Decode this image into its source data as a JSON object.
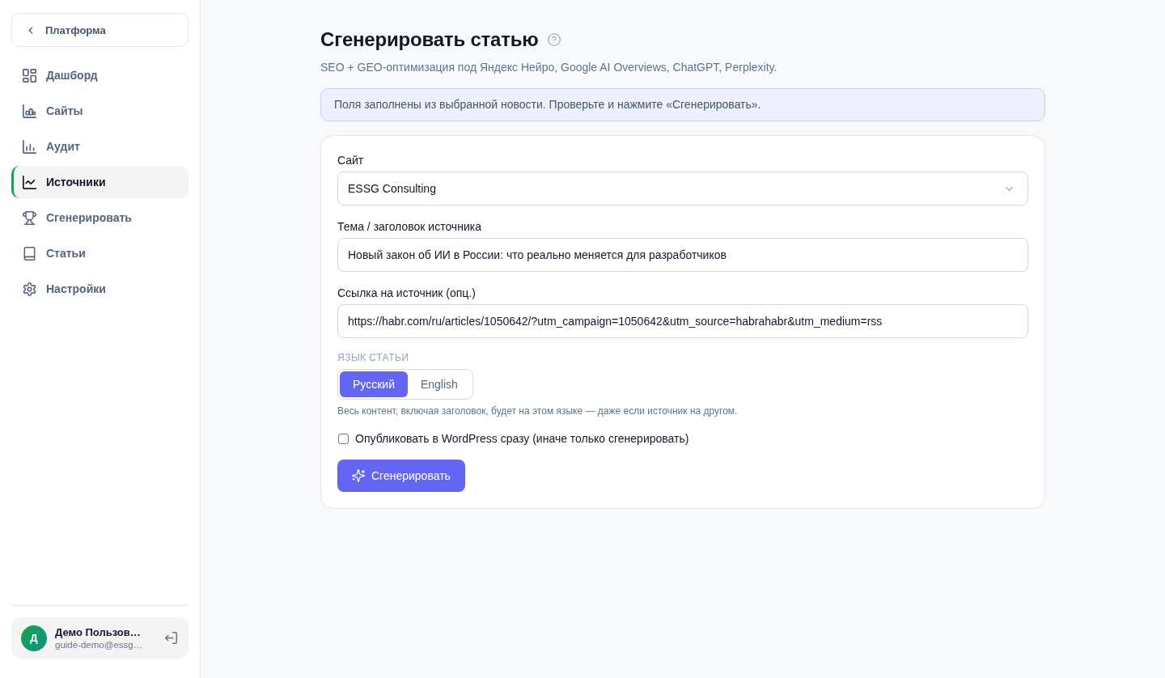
{
  "sidebar": {
    "back_button": {
      "label": "Платформа"
    },
    "nav": [
      {
        "label": "Дашборд",
        "selected": false
      },
      {
        "label": "Сайты",
        "selected": false
      },
      {
        "label": "Аудит",
        "selected": false
      },
      {
        "label": "Источники",
        "selected": true
      },
      {
        "label": "Сгенерировать",
        "selected": false
      },
      {
        "label": "Статьи",
        "selected": false
      },
      {
        "label": "Настройки",
        "selected": false
      }
    ],
    "user": {
      "avatar": "Д",
      "name": "Демо Пользов…",
      "email": "guide-demo@essg…"
    }
  },
  "page": {
    "title": "Сгенерировать статью",
    "subtitle": "SEO + GEO-оптимизация под Яндекс Нейро, Google AI Overviews, ChatGPT, Perplexity."
  },
  "notice": "Поля заполнены из выбранной новости. Проверьте и нажмите «Сгенерировать».",
  "form": {
    "fields": [
      {
        "kind": "select",
        "label": "Сайт",
        "value": "ESSG Consulting"
      },
      {
        "kind": "text",
        "label": "Тема / заголовок источника",
        "value": "Новый закон об ИИ в России: что реально меняется для разработчиков"
      },
      {
        "kind": "text",
        "label": "Ссылка на источник (опц.)",
        "value": "https://habr.com/ru/articles/1050642/?utm_campaign=1050642&utm_source=habrahabr&utm_medium=rss"
      }
    ],
    "language": {
      "label": "ЯЗЫК СТАТЬИ",
      "options": [
        {
          "label": "Русский",
          "selected": true
        },
        {
          "label": "English",
          "selected": false
        }
      ],
      "hint": "Весь контент, включая заголовок, будет на этом языке — даже если источник на другом."
    },
    "publish": {
      "label": "Опубликовать в WordPress сразу (иначе только сгенерировать)",
      "checked": false
    },
    "submit": {
      "label": "Сгенерировать"
    }
  }
}
